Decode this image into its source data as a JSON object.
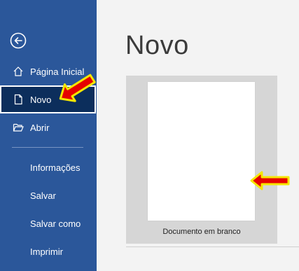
{
  "sidebar": {
    "back_icon": "back-arrow-circle-icon",
    "items": [
      {
        "label": "Página Inicial",
        "icon": "home-icon"
      },
      {
        "label": "Novo",
        "icon": "new-document-icon"
      },
      {
        "label": "Abrir",
        "icon": "open-folder-icon"
      }
    ],
    "secondary": [
      {
        "label": "Informações"
      },
      {
        "label": "Salvar"
      },
      {
        "label": "Salvar como"
      },
      {
        "label": "Imprimir"
      }
    ]
  },
  "main": {
    "title": "Novo",
    "templates": [
      {
        "label": "Documento em branco"
      }
    ]
  },
  "colors": {
    "sidebar": "#2b579a",
    "sidebar_active": "#0c2e5c",
    "annotation_arrow_fill": "#e60000",
    "annotation_arrow_outline": "#f5e600"
  }
}
